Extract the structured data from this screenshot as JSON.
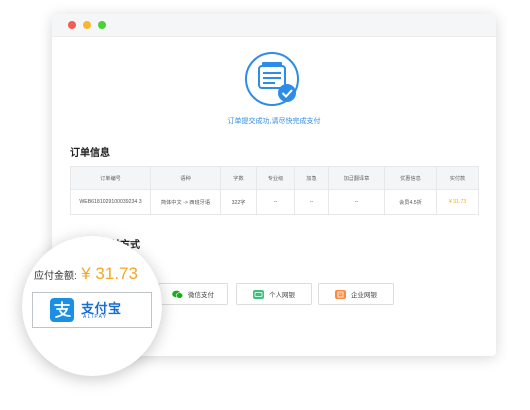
{
  "message": {
    "success": "订单提交成功,请尽快完成支付"
  },
  "order_section": {
    "title": "订单信息"
  },
  "order_table": {
    "headers": [
      "订单编号",
      "语种",
      "字数",
      "专业级",
      "加急",
      "加급翻译章",
      "优惠信息",
      "实付款"
    ],
    "row": [
      "WEB6181029100039234 3",
      "简体中文 -> 西班牙语",
      "322字",
      "--",
      "--",
      "--",
      "会员4.5折",
      "¥ 31.73"
    ]
  },
  "payment_section": {
    "title": "请选择支付方式"
  },
  "amount": {
    "label": "应付金额:",
    "value": "¥ 31.73"
  },
  "alipay": {
    "name": "支付宝",
    "latin": "ALIPAY"
  },
  "methods": {
    "wechat": "微信支付",
    "personal_bank": "个人网银",
    "enterprise_bank": "企业网银"
  },
  "colors": {
    "accent": "#2c8ce6",
    "price": "#f5a623",
    "alipay": "#1a6dd1",
    "wechat": "#1aad19",
    "bank": "#3cc07b",
    "enterprise": "#ff8a3d"
  }
}
